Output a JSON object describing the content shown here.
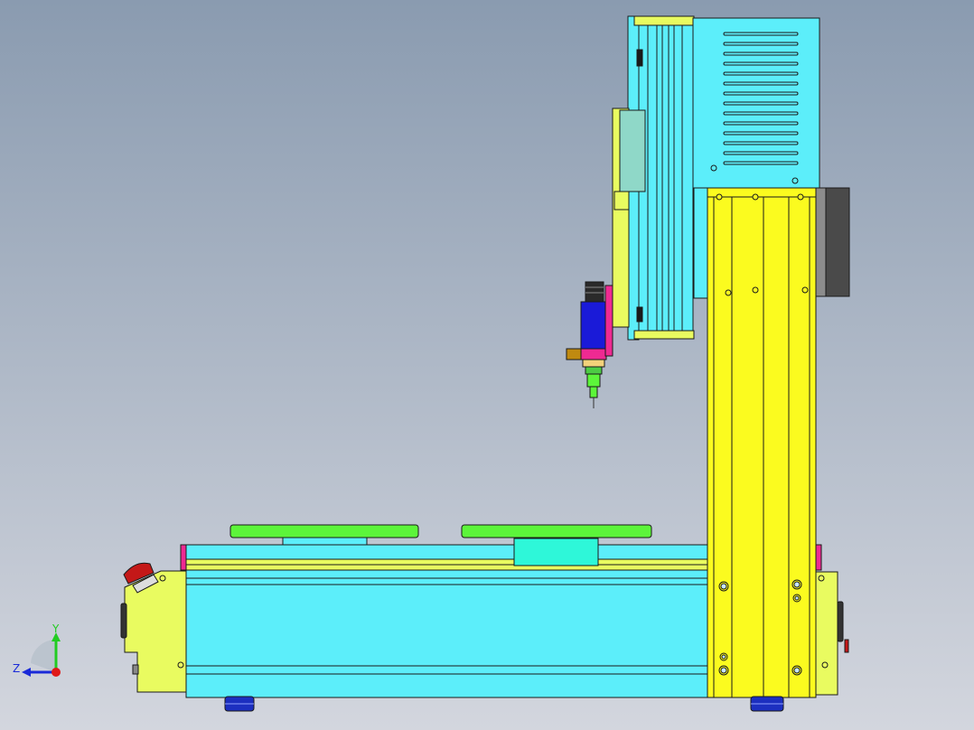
{
  "viewport": {
    "background_top": "#8a9bb0",
    "background_bottom": "#d3d6de"
  },
  "model": {
    "colors": {
      "frame_cyan": "#5ceefa",
      "column_yellow": "#fbfb1f",
      "panel_lime": "#e9fb60",
      "fixture_green": "#5cf53a",
      "estop_red": "#c41818",
      "valve_blue": "#1a1ad8",
      "accent_magenta": "#ee2a92",
      "motor_gray": "#4a4a4a",
      "foot_blue": "#1c2fc0",
      "outline": "#1a1a1a"
    },
    "icons": [
      "emergency-stop-button",
      "dispensing-valve",
      "vent-slots",
      "mounting-screws"
    ]
  },
  "triad": {
    "y_label": "Y",
    "z_label": "Z",
    "y_color": "#22cc22",
    "z_color": "#1a2ad8",
    "origin_color": "#e01818"
  }
}
